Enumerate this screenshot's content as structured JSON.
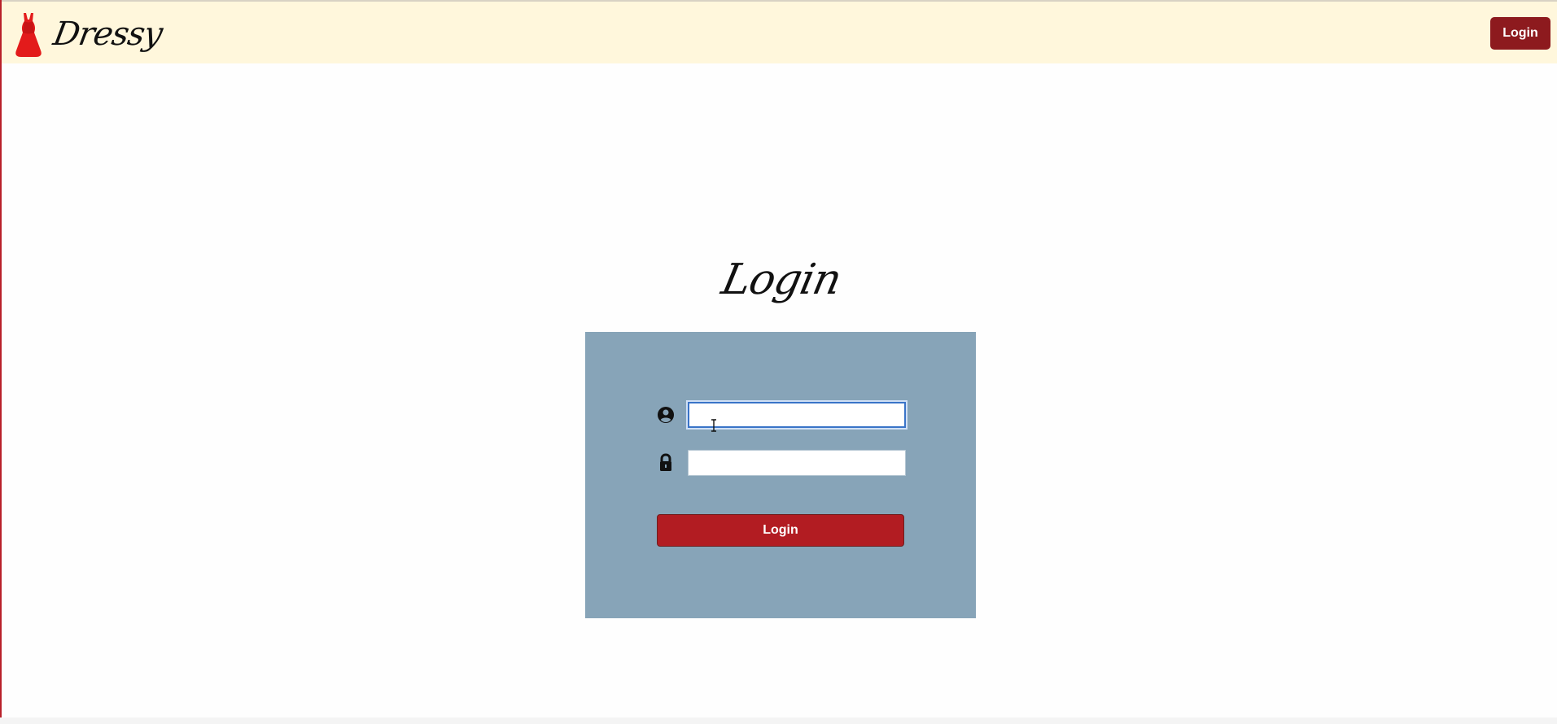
{
  "header": {
    "brand_name": "Dressy",
    "brand_icon": "red-dress-icon",
    "login_button_label": "Login"
  },
  "main": {
    "title": "Login",
    "username": {
      "icon": "user-circle-icon",
      "value": "",
      "placeholder": ""
    },
    "password": {
      "icon": "lock-icon",
      "value": "",
      "placeholder": ""
    },
    "submit_label": "Login"
  },
  "colors": {
    "header_background": "#fff7dc",
    "primary_button": "#b21c22",
    "header_button": "#8d1a1e",
    "panel_background": "#87a4b8",
    "focus_border": "#3a74c8"
  }
}
